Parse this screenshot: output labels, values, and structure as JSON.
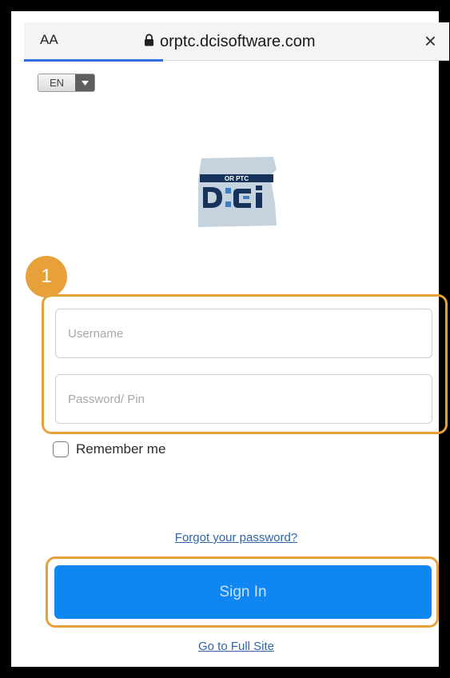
{
  "browser": {
    "text_size_label": "AA",
    "url": "orptc.dcisoftware.com",
    "close_glyph": "×",
    "lock_icon": "lock-icon"
  },
  "language": {
    "selected": "EN"
  },
  "logo": {
    "org_label": "OR PTC",
    "brand_text": "DCI",
    "colors": {
      "state_shape": "#c5d3df",
      "dark": "#16325a",
      "blue": "#3f7fbf"
    }
  },
  "annotations": {
    "step_number": "1",
    "highlight_color": "#e8a13a"
  },
  "form": {
    "username_placeholder": "Username",
    "password_placeholder": "Password/ Pin",
    "username_value": "",
    "password_value": "",
    "remember_label": "Remember me",
    "remember_checked": false,
    "forgot_link": "Forgot your password?",
    "signin_label": "Sign In",
    "fullsite_link": "Go to Full Site"
  },
  "colors": {
    "signin_button": "#0f86f2",
    "link": "#2e66a8"
  }
}
